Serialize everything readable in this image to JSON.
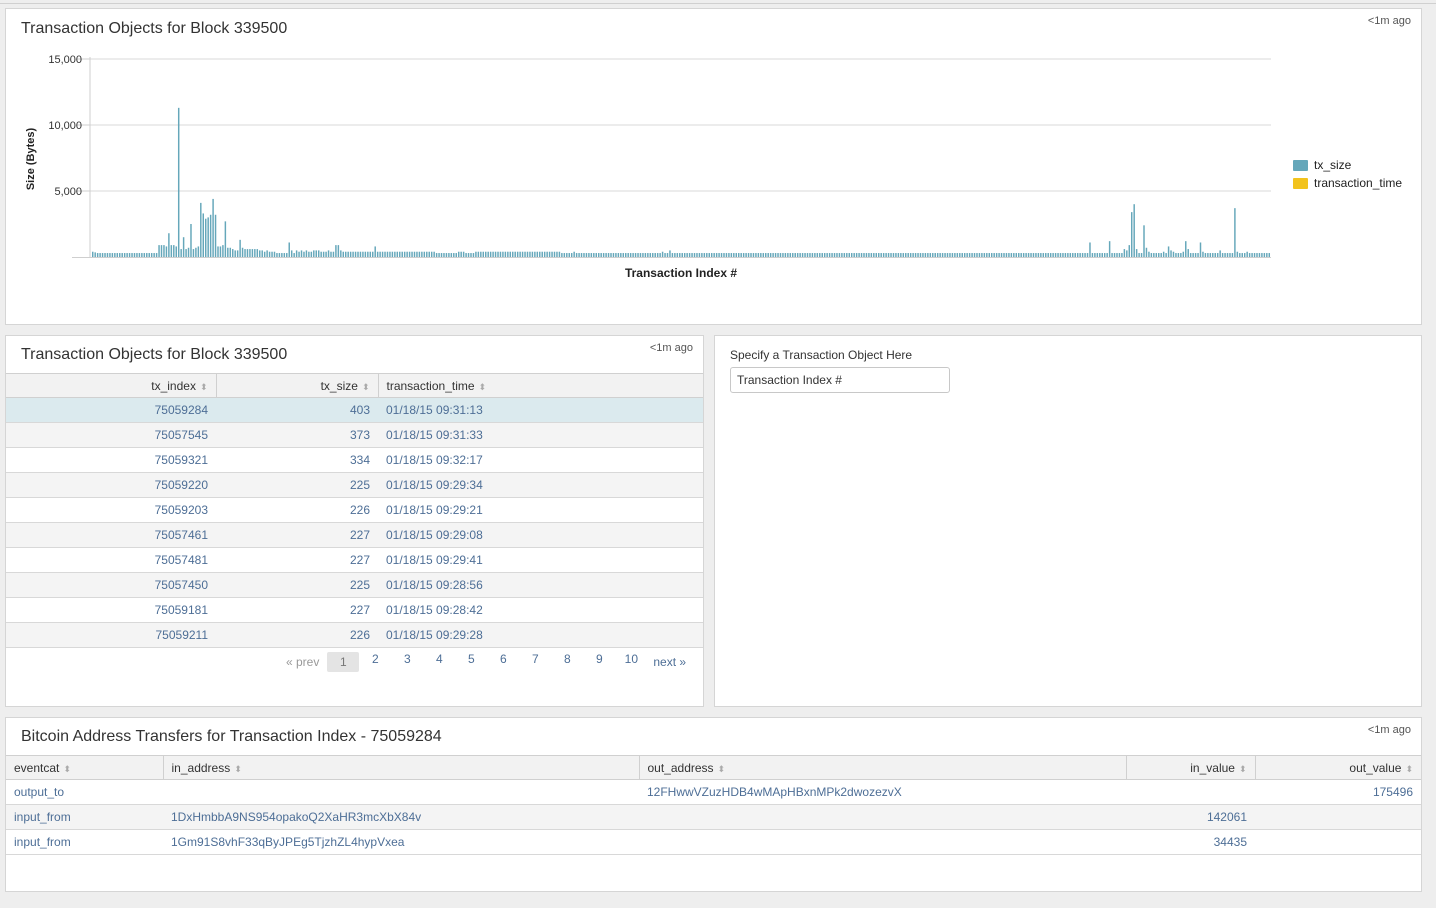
{
  "chart_panel": {
    "title": "Transaction Objects for Block 339500",
    "ago": "<1m ago"
  },
  "chart_data": {
    "type": "bar",
    "title": "Transaction Objects for Block 339500",
    "xlabel": "Transaction Index #",
    "ylabel": "Size (Bytes)",
    "ylim": [
      0,
      15000
    ],
    "yticks": [
      "15,000",
      "10,000",
      "5,000"
    ],
    "legend_position": "right",
    "series": [
      {
        "name": "tx_size",
        "color": "#65a7ba",
        "values": [
          400,
          350,
          300,
          300,
          300,
          300,
          300,
          300,
          300,
          300,
          300,
          300,
          300,
          300,
          300,
          300,
          300,
          300,
          300,
          300,
          300,
          300,
          300,
          300,
          300,
          300,
          300,
          900,
          900,
          900,
          800,
          1800,
          900,
          900,
          800,
          11300,
          600,
          1500,
          600,
          700,
          2500,
          600,
          700,
          800,
          4100,
          3300,
          2900,
          3000,
          3200,
          4400,
          3200,
          800,
          800,
          900,
          2700,
          700,
          700,
          600,
          500,
          500,
          1300,
          700,
          600,
          600,
          600,
          600,
          600,
          600,
          500,
          500,
          400,
          500,
          400,
          400,
          400,
          300,
          300,
          300,
          300,
          300,
          1100,
          500,
          300,
          500,
          400,
          500,
          400,
          500,
          400,
          400,
          500,
          500,
          500,
          400,
          400,
          400,
          500,
          400,
          400,
          900,
          900,
          500,
          400,
          400,
          400,
          400,
          400,
          400,
          400,
          400,
          400,
          400,
          400,
          400,
          400,
          800,
          400,
          400,
          400,
          400,
          400,
          400,
          400,
          400,
          400,
          400,
          400,
          400,
          400,
          400,
          400,
          400,
          400,
          400,
          400,
          400,
          400,
          400,
          400,
          400,
          300,
          300,
          300,
          300,
          300,
          300,
          300,
          300,
          300,
          400,
          400,
          400,
          300,
          300,
          300,
          300,
          400,
          400,
          400,
          400,
          400,
          400,
          400,
          400,
          400,
          400,
          400,
          400,
          400,
          400,
          400,
          400,
          400,
          400,
          400,
          400,
          400,
          400,
          400,
          400,
          400,
          400,
          400,
          400,
          400,
          400,
          400,
          400,
          400,
          400,
          400,
          300,
          300,
          300,
          300,
          300,
          400,
          300,
          300,
          300,
          300,
          300,
          300,
          300,
          300,
          300,
          300,
          300,
          300,
          300,
          300,
          300,
          300,
          300,
          300,
          300,
          300,
          300,
          300,
          300,
          300,
          300,
          300,
          300,
          300,
          300,
          300,
          300,
          300,
          300,
          300,
          300,
          400,
          300,
          300,
          500,
          300,
          300,
          300,
          300,
          300,
          300,
          300,
          300,
          300,
          300,
          300,
          300,
          300,
          300,
          300,
          300,
          300,
          300,
          300,
          300,
          300,
          300,
          300,
          300,
          300,
          300,
          300,
          300,
          300,
          300,
          300,
          300,
          300,
          300,
          300,
          300,
          300,
          300,
          300,
          300,
          300,
          300,
          300,
          300,
          300,
          300,
          300,
          300,
          300,
          300,
          300,
          300,
          300,
          300,
          300,
          300,
          300,
          300,
          300,
          300,
          300,
          300,
          300,
          300,
          300,
          300,
          300,
          300,
          300,
          300,
          300,
          300,
          300,
          300,
          300,
          300,
          300,
          300,
          300,
          300,
          300,
          300,
          300,
          300,
          300,
          300,
          300,
          300,
          300,
          300,
          300,
          300,
          300,
          300,
          300,
          300,
          300,
          300,
          300,
          300,
          300,
          300,
          300,
          300,
          300,
          300,
          300,
          300,
          300,
          300,
          300,
          300,
          300,
          300,
          300,
          300,
          300,
          300,
          300,
          300,
          300,
          300,
          300,
          300,
          300,
          300,
          300,
          300,
          300,
          300,
          300,
          300,
          300,
          300,
          300,
          300,
          300,
          300,
          300,
          300,
          300,
          300,
          300,
          300,
          300,
          300,
          300,
          300,
          300,
          300,
          300,
          300,
          300,
          300,
          300,
          300,
          300,
          300,
          300,
          300,
          300,
          300,
          300,
          300,
          300,
          300,
          300,
          300,
          300,
          300,
          1100,
          300,
          300,
          300,
          300,
          300,
          300,
          300,
          1200,
          300,
          300,
          300,
          300,
          300,
          600,
          500,
          900,
          3400,
          4000,
          600,
          300,
          300,
          2400,
          700,
          400,
          300,
          300,
          300,
          300,
          300,
          400,
          300,
          800,
          500,
          400,
          300,
          300,
          300,
          400,
          1200,
          600,
          300,
          300,
          300,
          300,
          1100,
          400,
          300,
          300,
          300,
          300,
          300,
          300,
          500,
          300,
          300,
          300,
          300,
          300,
          3700,
          400,
          300,
          300,
          300,
          400,
          300,
          300,
          300,
          300,
          300,
          300,
          300,
          300,
          300
        ]
      },
      {
        "name": "transaction_time",
        "color": "#f2c31d",
        "values": []
      }
    ]
  },
  "table_panel": {
    "title": "Transaction Objects for Block 339500",
    "ago": "<1m ago",
    "columns": [
      "tx_index",
      "tx_size",
      "transaction_time"
    ],
    "rows": [
      [
        "75059284",
        "403",
        "01/18/15 09:31:13"
      ],
      [
        "75057545",
        "373",
        "01/18/15 09:31:33"
      ],
      [
        "75059321",
        "334",
        "01/18/15 09:32:17"
      ],
      [
        "75059220",
        "225",
        "01/18/15 09:29:34"
      ],
      [
        "75059203",
        "226",
        "01/18/15 09:29:21"
      ],
      [
        "75057461",
        "227",
        "01/18/15 09:29:08"
      ],
      [
        "75057481",
        "227",
        "01/18/15 09:29:41"
      ],
      [
        "75057450",
        "225",
        "01/18/15 09:28:56"
      ],
      [
        "75059181",
        "227",
        "01/18/15 09:28:42"
      ],
      [
        "75059211",
        "226",
        "01/18/15 09:29:28"
      ]
    ],
    "pager": {
      "prev": "« prev",
      "pages": [
        "1",
        "2",
        "3",
        "4",
        "5",
        "6",
        "7",
        "8",
        "9",
        "10"
      ],
      "next": "next »"
    }
  },
  "input_panel": {
    "label": "Specify a Transaction Object Here",
    "placeholder": "Transaction Index #"
  },
  "transfers_panel": {
    "title": "Bitcoin Address Transfers for Transaction Index - 75059284",
    "ago": "<1m ago",
    "columns": [
      "eventcat",
      "in_address",
      "out_address",
      "in_value",
      "out_value"
    ],
    "rows": [
      [
        "output_to",
        "",
        "12FHwwVZuzHDB4wMApHBxnMPk2dwozezvX",
        "",
        "175496"
      ],
      [
        "input_from",
        "1DxHmbbA9NS954opakoQ2XaHR3mcXbX84v",
        "",
        "142061",
        ""
      ],
      [
        "input_from",
        "1Gm91S8vhF33qByJPEg5TjzhZL4hypVxea",
        "",
        "34435",
        ""
      ]
    ]
  }
}
